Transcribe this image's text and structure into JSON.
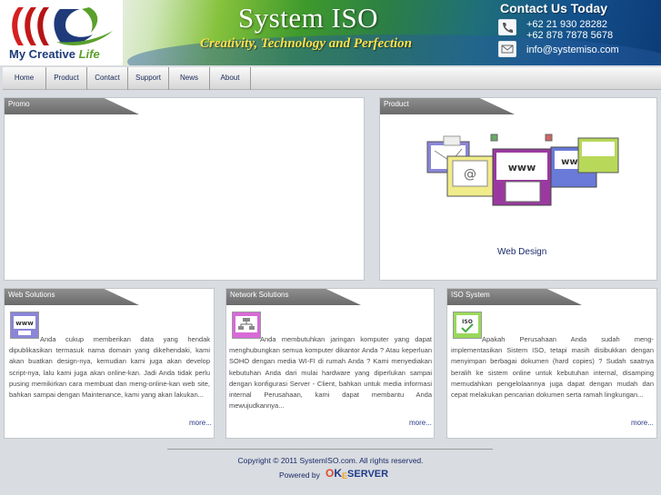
{
  "header": {
    "logo_tagline_main": "My Creative ",
    "logo_tagline_accent": "Life",
    "site_title": "System ISO",
    "tagline": "Creativity, Technology and Perfection",
    "contact_title": "Contact Us Today",
    "phone_1": "+62 21 930 28282",
    "phone_2": "+62 878 7878 5678",
    "email": "info@systemiso.com"
  },
  "nav": {
    "items": [
      {
        "label": "Home"
      },
      {
        "label": "Product"
      },
      {
        "label": "Contact"
      },
      {
        "label": "Support"
      },
      {
        "label": "News"
      },
      {
        "label": "About"
      }
    ]
  },
  "promo": {
    "title": "Promo"
  },
  "product": {
    "title": "Product",
    "caption": "Web Design"
  },
  "web_solutions": {
    "title": "Web Solutions",
    "body": "Anda cukup memberikan data yang hendak dipublikasikan termasuk nama domain yang dikehendaki, kami akan buatkan design-nya, kemudian kami juga akan develop script-nya, lalu kami juga akan online-kan. Jadi Anda tidak perlu pusing memikirkan cara membuat dan meng-online-kan web site, bahkan sampai dengan Maintenance, kami yang akan lakukan...",
    "more": "more..."
  },
  "network_solutions": {
    "title": "Network Solutions",
    "body": "Anda membutuhkan jaringan komputer yang dapat menghubungkan semua komputer dikantor Anda ? Atau keperluan SOHO dengan media WI-FI di rumah Anda ? Kami menyediakan kebutuhan Anda dari mulai hardware yang diperlukan sampai dengan konfigurasi Server - Client, bahkan untuk media informasi internal Perusahaan, kami dapat membantu Anda mewujudkannya...",
    "more": "more..."
  },
  "iso_system": {
    "title": "ISO System",
    "body": "Apakah Perusahaan Anda sudah meng-implementasikan Sistem ISO, tetapi masih disibukkan dengan menyimpan berbagai dokumen (hard copies) ? Sudah saatnya beralih ke sistem online untuk kebutuhan internal, disamping memudahkan pengelolaannya juga dapat dengan mudah dan cepat melakukan pencarian dokumen serta ramah lingkungan...",
    "more": "more..."
  },
  "footer": {
    "copyright": "Copyright © 2011 SystemISO.com. All rights reserved.",
    "powered_by": "Powered by",
    "oke_o": "O",
    "oke_ke": "K",
    "oke_e": "E",
    "oke_server": "SERVER"
  },
  "colors": {
    "nav_text": "#1a2a5a",
    "panel_header": "#7a7a7a",
    "link": "#2a3a8a",
    "tagline": "#ffe04a"
  }
}
